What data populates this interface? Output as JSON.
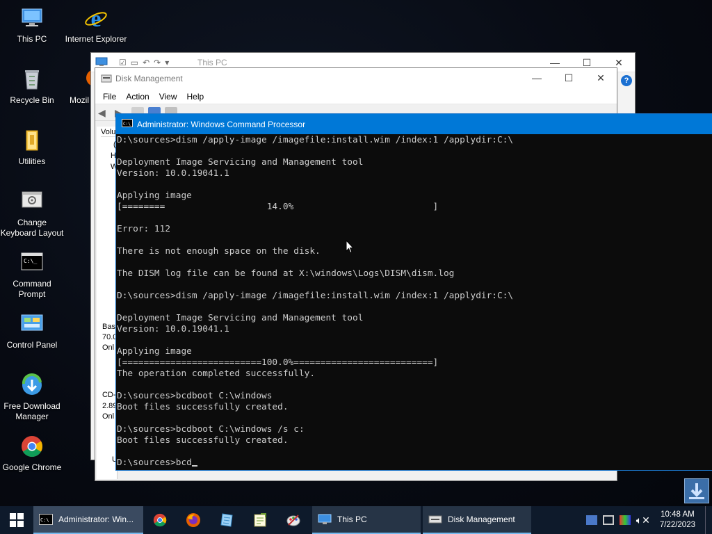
{
  "desktop": {
    "icons": [
      {
        "label": "This PC"
      },
      {
        "label": "Internet Explorer"
      },
      {
        "label": "Recycle Bin"
      },
      {
        "label": "Mozil"
      },
      {
        "label": "Utilities"
      },
      {
        "label": "Change Keyboard Layout"
      },
      {
        "label": "Command Prompt"
      },
      {
        "label": "Control Panel"
      },
      {
        "label": "Free Download Manager"
      },
      {
        "label": "Google Chrome"
      }
    ]
  },
  "thispc_window": {
    "title": "This PC"
  },
  "diskmgmt_window": {
    "title": "Disk Management",
    "menu": [
      "File",
      "Action",
      "View",
      "Help"
    ],
    "left_column_fragments": [
      "Volu",
      "(",
      "H",
      "W",
      "Basi",
      "70.0",
      "Onl",
      "CD-",
      "2.89",
      "Onl",
      "U"
    ]
  },
  "cmd_window": {
    "title": "Administrator: Windows Command Processor",
    "output": "D:\\sources>dism /apply-image /imagefile:install.wim /index:1 /applydir:C:\\\n\nDeployment Image Servicing and Management tool\nVersion: 10.0.19041.1\n\nApplying image\n[========                   14.0%                          ]\n\nError: 112\n\nThere is not enough space on the disk.\n\nThe DISM log file can be found at X:\\windows\\Logs\\DISM\\dism.log\n\nD:\\sources>dism /apply-image /imagefile:install.wim /index:1 /applydir:C:\\\n\nDeployment Image Servicing and Management tool\nVersion: 10.0.19041.1\n\nApplying image\n[==========================100.0%==========================]\nThe operation completed successfully.\n\nD:\\sources>bcdboot C:\\windows\nBoot files successfully created.\n\nD:\\sources>bcdboot C:\\windows /s c:\nBoot files successfully created.\n\nD:\\sources>bcd"
  },
  "taskbar": {
    "apps": [
      {
        "label": "Administrator: Win..."
      },
      {
        "label": "This PC"
      },
      {
        "label": "Disk Management"
      }
    ],
    "clock": {
      "time": "10:48 AM",
      "date": "7/22/2023"
    }
  },
  "colors": {
    "accent": "#0078d7",
    "taskbar": "#0e1a2b",
    "console_bg": "#0c0c0c",
    "console_text": "#cccccc"
  }
}
